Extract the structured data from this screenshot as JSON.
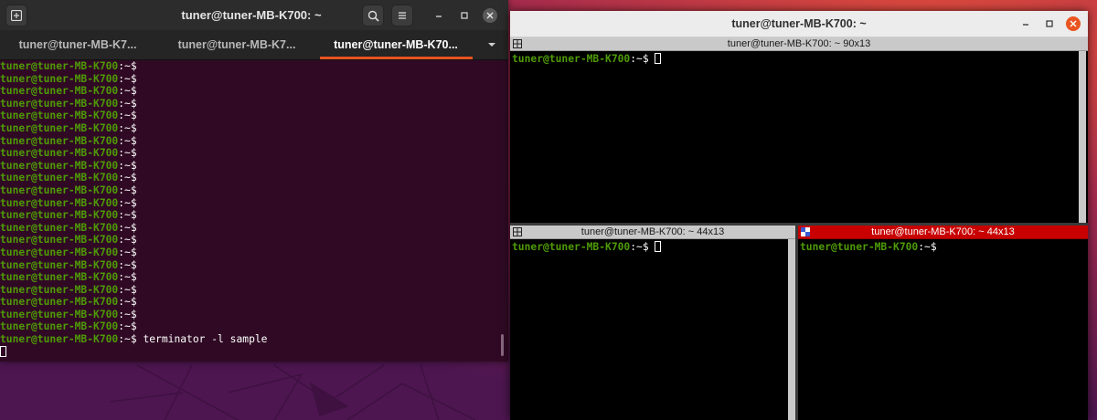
{
  "gnome_terminal": {
    "title": "tuner@tuner-MB-K700: ~",
    "tabs": [
      {
        "label": "tuner@tuner-MB-K7..."
      },
      {
        "label": "tuner@tuner-MB-K7..."
      },
      {
        "label": "tuner@tuner-MB-K70..."
      }
    ],
    "active_tab": 2,
    "prompt_user": "tuner@tuner-MB-K700",
    "prompt_path": ":~$",
    "empty_prompt_lines": 22,
    "last_command": " terminator -l sample",
    "icons": [
      "new-tab-icon",
      "search-icon",
      "hamburger-menu-icon",
      "minimize-icon",
      "maximize-icon",
      "close-icon",
      "tab-list-dropdown-icon"
    ]
  },
  "terminator": {
    "title": "tuner@tuner-MB-K700: ~",
    "panes": [
      {
        "title": "tuner@tuner-MB-K700: ~ 90x13",
        "prompt_user": "tuner@tuner-MB-K700",
        "prompt_path": ":~$",
        "focused": false
      },
      {
        "title": "tuner@tuner-MB-K700: ~ 44x13",
        "prompt_user": "tuner@tuner-MB-K700",
        "prompt_path": ":~$",
        "focused": false
      },
      {
        "title": "tuner@tuner-MB-K700: ~ 44x13",
        "prompt_user": "tuner@tuner-MB-K700",
        "prompt_path": ":~$",
        "focused": true
      }
    ]
  },
  "colors": {
    "terminal_bg": "#300a24",
    "prompt_green": "#4e9a06",
    "accent_orange": "#e95420",
    "focused_pane_red": "#c80000"
  }
}
